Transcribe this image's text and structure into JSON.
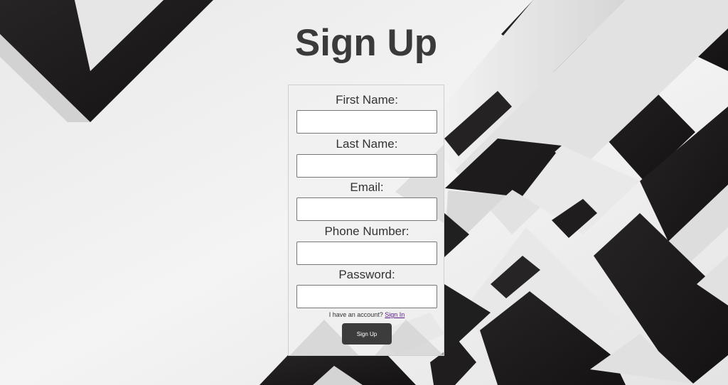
{
  "page": {
    "title": "Sign Up"
  },
  "form": {
    "fields": [
      {
        "label": "First Name:",
        "value": "",
        "type": "text"
      },
      {
        "label": "Last Name:",
        "value": "",
        "type": "text"
      },
      {
        "label": "Email:",
        "value": "",
        "type": "email"
      },
      {
        "label": "Phone Number:",
        "value": "",
        "type": "tel"
      },
      {
        "label": "Password:",
        "value": "",
        "type": "password"
      }
    ],
    "account_prompt": "I have an account?",
    "sign_in_link": "Sign In",
    "submit_label": "Sign Up"
  },
  "colors": {
    "dark_band": "#1f1d1e",
    "light_band": "#e8e8e8",
    "background": "#f0f0f0",
    "button": "#3c3c3c",
    "link": "#5b1a8a"
  }
}
